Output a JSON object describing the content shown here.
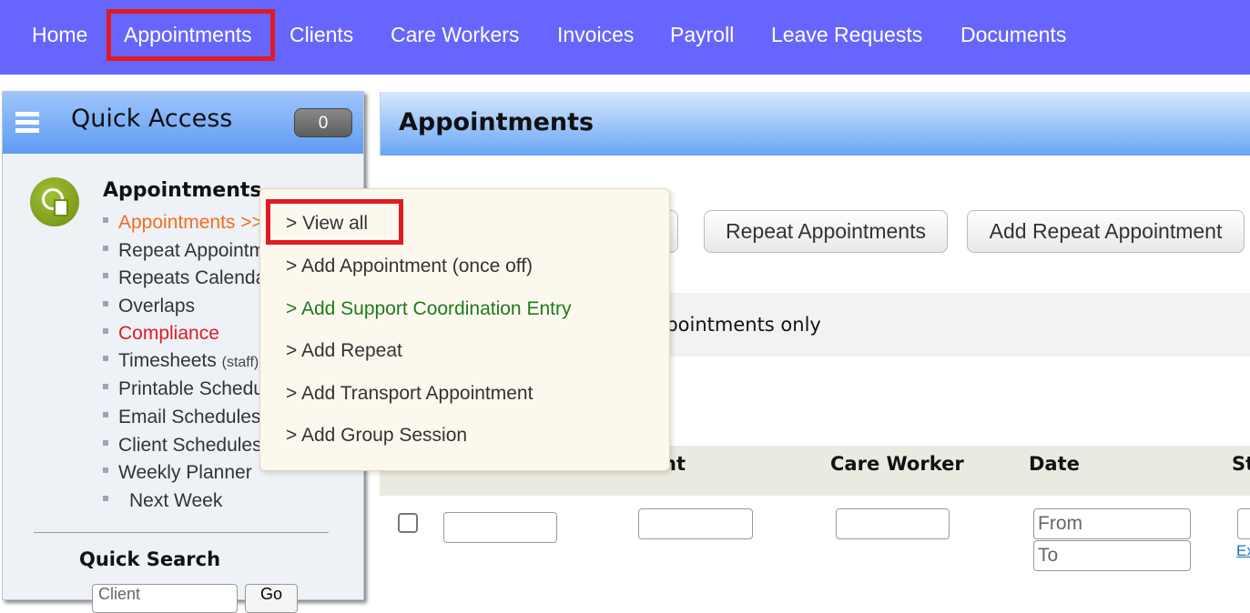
{
  "topnav": {
    "items": [
      "Home",
      "Appointments",
      "Clients",
      "Care Workers",
      "Invoices",
      "Payroll",
      "Leave Requests",
      "Documents"
    ],
    "active": "Appointments"
  },
  "sidebar": {
    "title": "Quick Access",
    "badge": "0",
    "section_title": "Appointments",
    "links": [
      {
        "label": "Appointments >>",
        "color": "#f26c21"
      },
      {
        "label": "Repeat Appointments",
        "color": "#333333"
      },
      {
        "label": "Repeats Calendar",
        "color": "#333333"
      },
      {
        "label": "Overlaps",
        "color": "#333333"
      },
      {
        "label": "Compliance",
        "color": "#e01b24"
      },
      {
        "label": "Timesheets",
        "suffix": "(staff)",
        "color": "#333333"
      },
      {
        "label": "Printable Schedules",
        "color": "#333333"
      },
      {
        "label": "Email Schedules",
        "color": "#333333"
      },
      {
        "label": "Client Schedules",
        "color": "#333333"
      },
      {
        "label": "Weekly Planner",
        "color": "#333333"
      },
      {
        "label": "Next Week",
        "color": "#333333"
      }
    ],
    "quick_search_title": "Quick Search",
    "quick_search_placeholder": "Client",
    "go_label": "Go"
  },
  "main": {
    "title": "Appointments",
    "buttons": {
      "repeat_appointments": "Repeat Appointments",
      "add_repeat_appointment": "Add Repeat Appointment"
    },
    "filter_text": "ppointments only",
    "table_headers": {
      "client_partial": "nt",
      "care_worker": "Care Worker",
      "date": "Date",
      "status_partial": "St"
    },
    "date_from_placeholder": "From",
    "date_to_placeholder": "To",
    "ex_link_partial": "Ex"
  },
  "dropdown": {
    "items": [
      {
        "label": "> View all",
        "color": "#333333"
      },
      {
        "label": "> Add Appointment (once off)",
        "color": "#333333"
      },
      {
        "label": "> Add Support Coordination Entry",
        "color": "#1e7b1e"
      },
      {
        "label": "> Add Repeat",
        "color": "#333333"
      },
      {
        "label": "> Add Transport Appointment",
        "color": "#333333"
      },
      {
        "label": "> Add Group Session",
        "color": "#333333"
      }
    ]
  },
  "colors": {
    "nav_bg": "#6666ff",
    "highlight": "#e01b24",
    "accent_orange": "#f26c21"
  }
}
